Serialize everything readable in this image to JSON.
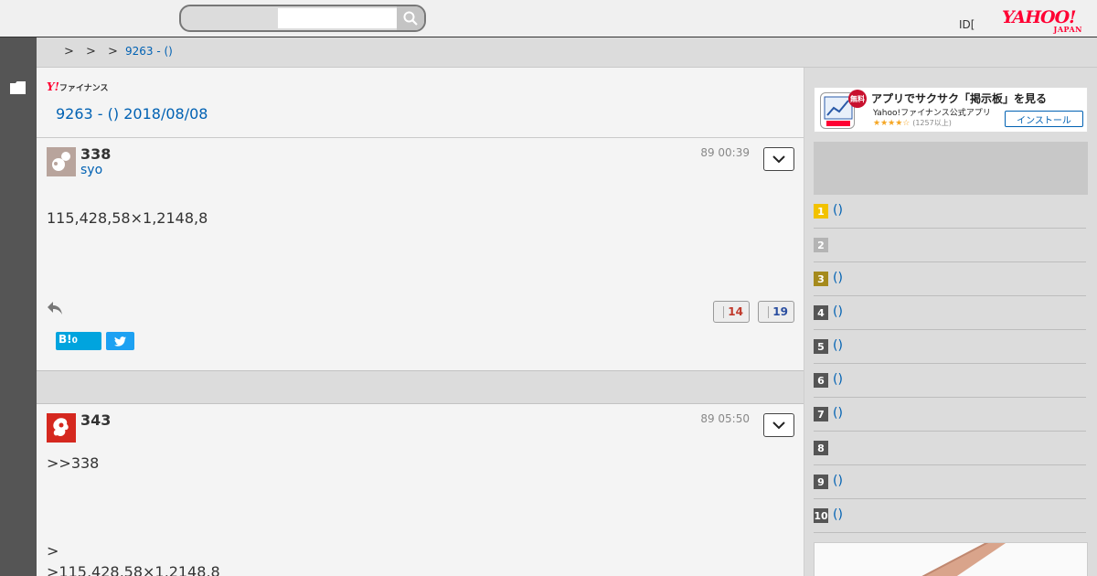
{
  "header": {
    "search": {
      "value": "",
      "placeholder": ""
    },
    "id_text": "ID[",
    "logo_main": "YAHOO!",
    "logo_sub": "JAPAN"
  },
  "breadcrumb": {
    "separators": [
      ">",
      ">",
      ">"
    ],
    "current": "9263 - ()"
  },
  "board": {
    "logo_y": "Y!",
    "logo_text": "ファイナンス",
    "title": "9263 - () 2018/08/08"
  },
  "posts": [
    {
      "number": "338",
      "user": "syo",
      "time": "89 00:39",
      "body": "115,428,58×1,2148,8",
      "likes": "14",
      "dislikes": "19",
      "hatena": "B!",
      "hatena_count": "0"
    },
    {
      "number": "343",
      "time": "89 05:50",
      "body": ">>338",
      "quote_marker": ">",
      "quote_text": ">115,428,58×1,2148,8"
    }
  ],
  "sidebar": {
    "app_banner": {
      "free_badge": "無料",
      "title": "アプリでサクサク「掲示板」を見る",
      "subtitle": "Yahoo!ファイナンス公式アプリ",
      "stars": "★★★★☆",
      "review_count": "(1257以上)",
      "install_label": "インストール"
    },
    "ranking": [
      {
        "rank": "1",
        "label": "()",
        "color": "#f2c200"
      },
      {
        "rank": "2",
        "label": "",
        "color": "#b4b4b4"
      },
      {
        "rank": "3",
        "label": "()",
        "color": "#a58a1c"
      },
      {
        "rank": "4",
        "label": "()",
        "color": "#555555"
      },
      {
        "rank": "5",
        "label": "()",
        "color": "#555555"
      },
      {
        "rank": "6",
        "label": "()",
        "color": "#555555"
      },
      {
        "rank": "7",
        "label": "()",
        "color": "#555555"
      },
      {
        "rank": "8",
        "label": "",
        "color": "#555555"
      },
      {
        "rank": "9",
        "label": "()",
        "color": "#555555"
      },
      {
        "rank": "10",
        "label": "()",
        "color": "#555555"
      }
    ]
  },
  "colors": {
    "link": "#0061b3",
    "brand": "#ff0033"
  }
}
